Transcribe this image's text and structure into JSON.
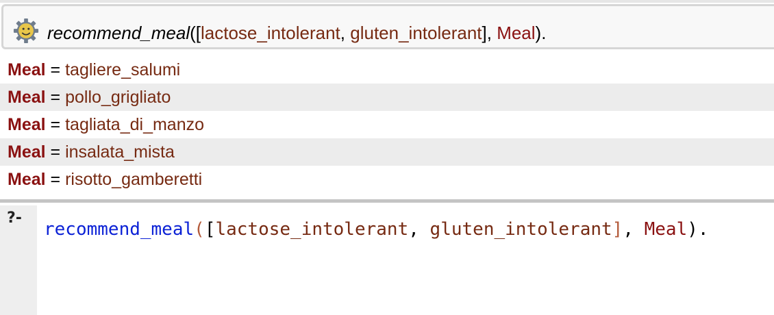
{
  "query": {
    "icon": "gear-smiley-icon",
    "functor": "recommend_meal",
    "open": "([",
    "arg1": "lactose_intolerant",
    "comma1": ", ",
    "arg2": "gluten_intolerant",
    "close_list": "], ",
    "var": "Meal",
    "end": ")."
  },
  "answers": [
    {
      "var": "Meal",
      "eq": " = ",
      "value": "tagliere_salumi"
    },
    {
      "var": "Meal",
      "eq": " = ",
      "value": "pollo_grigliato"
    },
    {
      "var": "Meal",
      "eq": " = ",
      "value": "tagliata_di_manzo"
    },
    {
      "var": "Meal",
      "eq": " = ",
      "value": "insalata_mista"
    },
    {
      "var": "Meal",
      "eq": " = ",
      "value": "risotto_gamberetti"
    }
  ],
  "prompt": {
    "label": "?-",
    "functor": "recommend_meal",
    "open_paren": "(",
    "open_bracket": "[",
    "arg1": "lactose_intolerant",
    "comma1": ", ",
    "arg2": "gluten_intolerant",
    "close_bracket": "]",
    "comma2": ", ",
    "var": "Meal",
    "end": ")."
  },
  "colors": {
    "variable": "#8a1111",
    "atom": "#762a12",
    "functor_editor": "#0c22d6",
    "paren_editor": "#b35a3a"
  }
}
